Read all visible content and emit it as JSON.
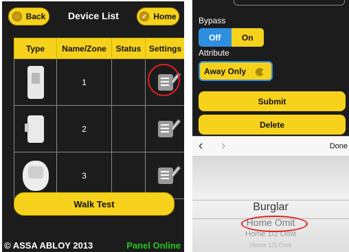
{
  "left": {
    "header": {
      "back_label": "Back",
      "title": "Device List",
      "home_label": "Home"
    },
    "table": {
      "columns": [
        "Type",
        "Name/Zone",
        "Status",
        "Settings"
      ],
      "rows": [
        {
          "type_icon": "door-window-sensor-icon",
          "zone": "1",
          "status": ""
        },
        {
          "type_icon": "plug-sensor-icon",
          "zone": "2",
          "status": ""
        },
        {
          "type_icon": "motion-sensor-icon",
          "zone": "3",
          "status": ""
        }
      ]
    },
    "walk_test_label": "Walk Test",
    "footer": {
      "copyright": "© ASSA ABLOY 2013",
      "panel_status": "Panel Online"
    }
  },
  "right": {
    "bypass_label": "Bypass",
    "bypass_options": [
      "Off",
      "On"
    ],
    "attribute_label": "Attribute",
    "attribute_value": "Away Only",
    "submit_label": "Submit",
    "delete_label": "Delete",
    "picker_toolbar": {
      "done_label": "Done"
    },
    "picker_options": [
      "Burglar",
      "Home Omit",
      "Home 1/2 Omit",
      "Home 1/3 Omit"
    ]
  },
  "colors": {
    "accent": "#f6d21c",
    "background": "#1c1c1c",
    "online": "#22c81f",
    "highlight": "#e02020",
    "segment_blue": "#2e8fe0"
  }
}
